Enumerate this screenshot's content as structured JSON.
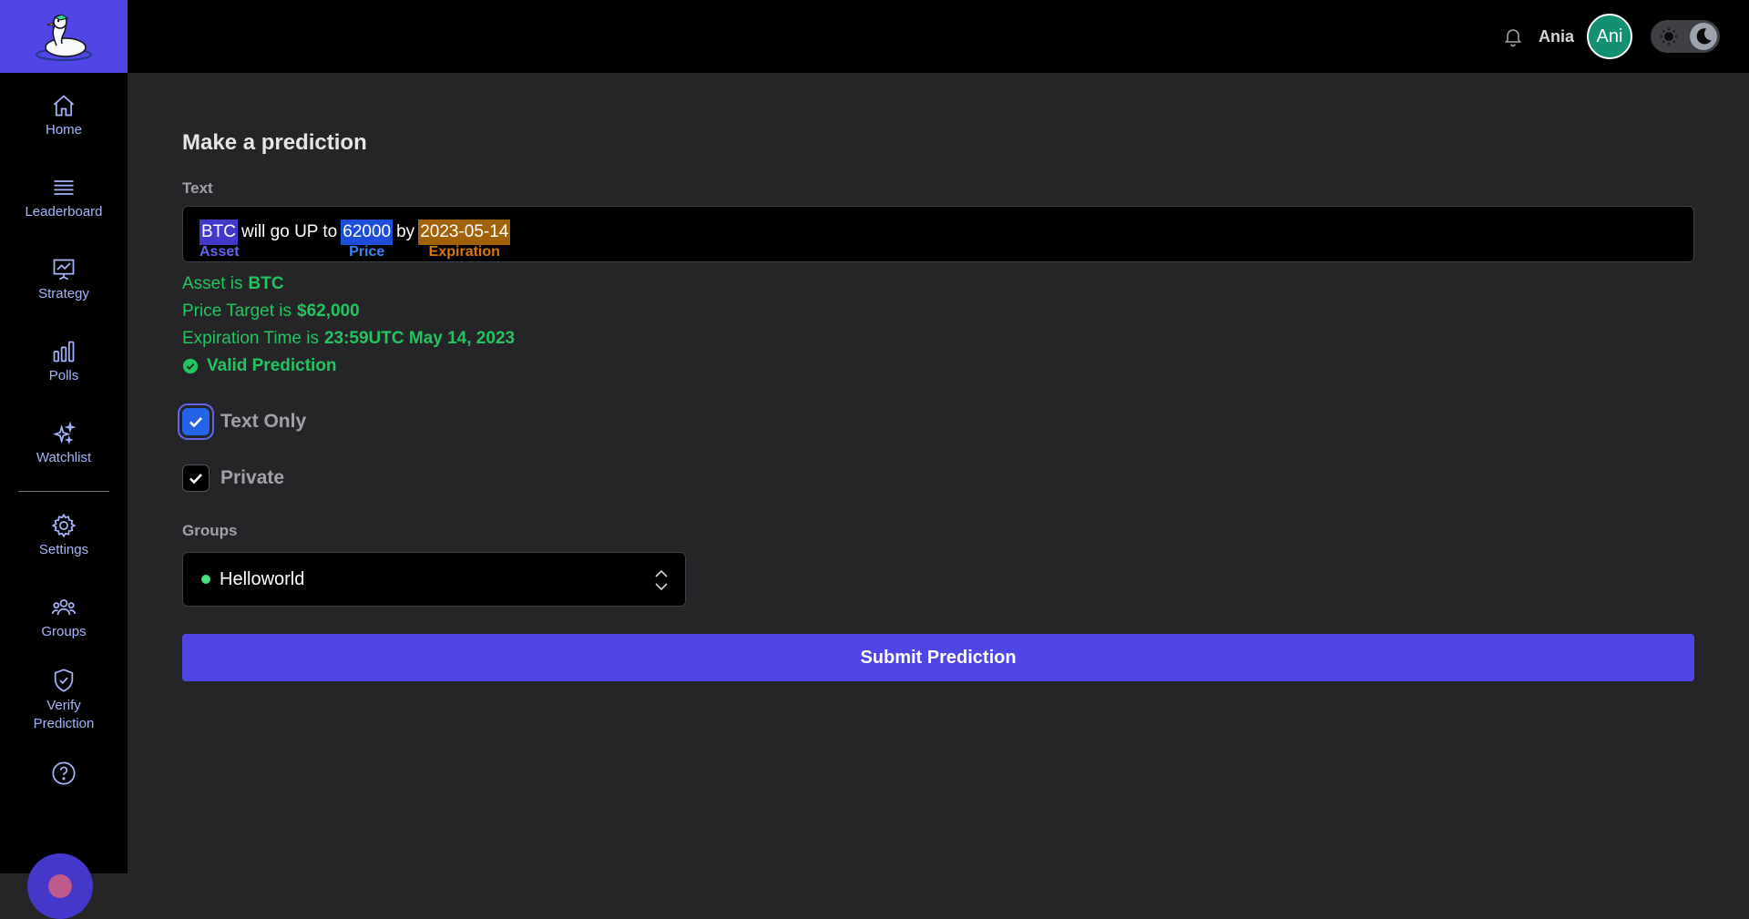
{
  "header": {
    "logo": "duck-logo",
    "username": "Ania",
    "avatar_initials": "Ani",
    "notification_icon": "bell-icon",
    "theme_toggle": {
      "light_icon": "sun-icon",
      "dark_icon": "moon-icon",
      "mode": "dark"
    }
  },
  "sidebar": {
    "items": [
      {
        "label": "Home",
        "icon": "home-icon"
      },
      {
        "label": "Leaderboard",
        "icon": "list-icon"
      },
      {
        "label": "Strategy",
        "icon": "presentation-chart-icon"
      },
      {
        "label": "Polls",
        "icon": "bar-chart-icon"
      },
      {
        "label": "Watchlist",
        "icon": "sparkles-icon"
      },
      {
        "label": "Settings",
        "icon": "gear-icon"
      },
      {
        "label": "Groups",
        "icon": "users-icon"
      },
      {
        "label": "Verify Prediction",
        "icon": "shield-check-icon"
      },
      {
        "label": "",
        "icon": "help-icon"
      }
    ]
  },
  "main": {
    "title": "Make a prediction",
    "text_label": "Text",
    "prediction_text": {
      "asset": "BTC",
      "w1": "will go UP to",
      "price": "62000",
      "w2": "by",
      "expiration": "2023-05-14",
      "asset_tag": "Asset",
      "price_tag": "Price",
      "expiration_tag": "Expiration"
    },
    "parsed": {
      "asset_label": "Asset is",
      "asset_value": "BTC",
      "price_label": "Price Target is",
      "price_value": "$62,000",
      "expiration_label": "Expiration Time is",
      "expiration_value": "23:59UTC May 14, 2023",
      "valid_text": "Valid Prediction"
    },
    "options": {
      "text_only_label": "Text Only",
      "text_only_checked": true,
      "private_label": "Private",
      "private_checked": true
    },
    "groups_label": "Groups",
    "groups_selected": "Helloworld",
    "submit_label": "Submit Prediction"
  },
  "colors": {
    "accent": "#4f46e5",
    "success": "#22c55e",
    "asset_highlight": "#4338ca",
    "price_highlight": "#1d4ed8",
    "expiration_highlight": "#a16207",
    "avatar": "#129071"
  }
}
